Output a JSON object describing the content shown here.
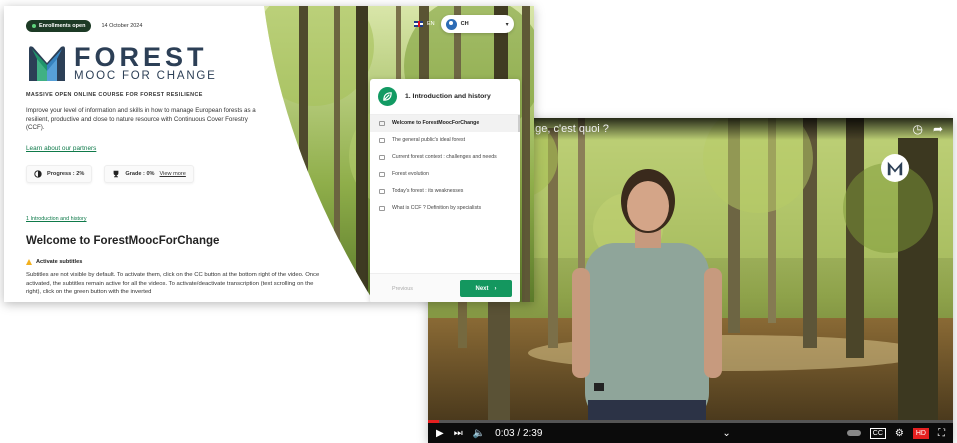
{
  "video": {
    "title": "...ge, c'est quoi ?",
    "time": "0:03 / 2:39",
    "progress": 0.02,
    "cc_label": "CC",
    "hd_label": "HD"
  },
  "course": {
    "enrollment_badge": "Enrollments open",
    "date": "14 October 2024",
    "logo_main": "FOREST",
    "logo_sub": "MOOC FOR CHANGE",
    "tagline": "MASSIVE OPEN ONLINE COURSE FOR FOREST RESILIENCE",
    "intro": "Improve your level of information and skills in how to manage European forests as a resilient, productive and close to nature resource with Continuous Cover Forestry (CCF).",
    "partners_link": "Learn about our partners",
    "progress_label": "Progress : 2%",
    "grade_label": "Grade : 0%",
    "view_more": "View more",
    "breadcrumb": "1 Introduction and history",
    "lesson_title": "Welcome to ForestMoocForChange",
    "subtitles_heading": "Activate subtitles",
    "subtitles_text": "Subtitles are not visible by default. To activate them, click on the CC button at the bottom right of the video. Once activated, the subtitles remain active for all the videos. To activate/deactivate transcription (text scrolling on the right), click on the green button with the inverted"
  },
  "header": {
    "language": "EN",
    "user": "CH"
  },
  "module_panel": {
    "title": "1. Introduction and history",
    "lessons": [
      "Welcome to ForestMoocForChange",
      "The general public's ideal forest",
      "Current forest context : challenges and needs",
      "Forest evolution",
      "Today's forest : its weaknesses",
      "What is CCF ? Definition by specialists"
    ],
    "previous": "Previous",
    "next": "Next"
  },
  "colors": {
    "brand_green": "#14975f",
    "logo_navy": "#2c3f56",
    "badge_dark": "#1c3a25",
    "video_progress": "#e52020"
  }
}
